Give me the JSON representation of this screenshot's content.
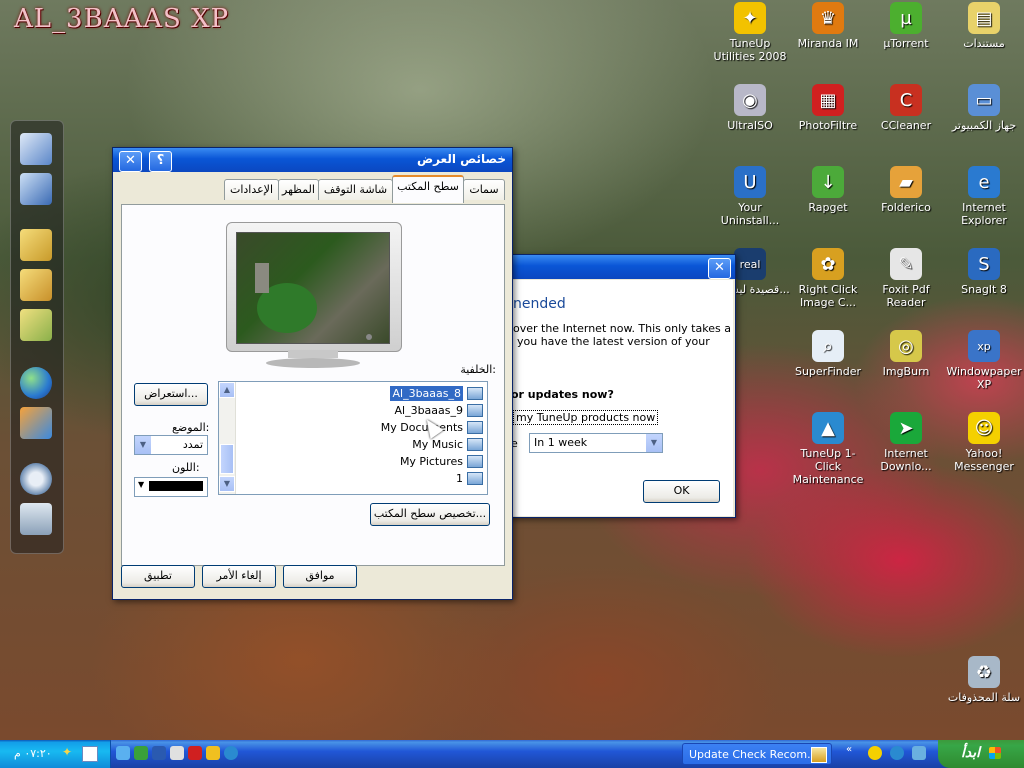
{
  "desktop": {
    "logo_text": "AL_3BAAAS XP",
    "icons": [
      {
        "label": "TuneUp Utilities 2008",
        "icon": "tuneup-icon",
        "color": "#f2c200",
        "glyph": "✦"
      },
      {
        "label": "Miranda IM",
        "icon": "miranda-icon",
        "color": "#e07a10",
        "glyph": "♛"
      },
      {
        "label": "µTorrent",
        "icon": "utorrent-icon",
        "color": "#4caf2f",
        "glyph": "µ"
      },
      {
        "label": "مستندات",
        "icon": "documents-icon",
        "color": "#e8d26a",
        "glyph": "▤"
      },
      {
        "label": "UltraISO",
        "icon": "ultraiso-icon",
        "color": "#b8b8c8",
        "glyph": "◉"
      },
      {
        "label": "PhotoFiltre",
        "icon": "photofiltre-icon",
        "color": "#d02020",
        "glyph": "▦"
      },
      {
        "label": "CCleaner",
        "icon": "ccleaner-icon",
        "color": "#c83020",
        "glyph": "C"
      },
      {
        "label": "جهاز الكمبيوتر",
        "icon": "my-computer-icon",
        "color": "#5a8fd6",
        "glyph": "▭"
      },
      {
        "label": "Your Uninstall...",
        "icon": "your-uninstaller-icon",
        "color": "#2a70c8",
        "glyph": "U"
      },
      {
        "label": "Rapget",
        "icon": "rapget-icon",
        "color": "#4caa3a",
        "glyph": "↓"
      },
      {
        "label": "Folderico",
        "icon": "folderico-icon",
        "color": "#e6a23a",
        "glyph": "▰"
      },
      {
        "label": "Internet Explorer",
        "icon": "internet-explorer-icon",
        "color": "#2a7ad0",
        "glyph": "e"
      },
      {
        "label": "قصيدة ليس لها...",
        "icon": "realplayer-icon",
        "color": "#1a3d6e",
        "glyph": "real"
      },
      {
        "label": "Right Click Image C...",
        "icon": "right-click-image-icon",
        "color": "#d8a020",
        "glyph": "✿"
      },
      {
        "label": "Foxit Pdf Reader",
        "icon": "foxit-reader-icon",
        "color": "#e6e6e6",
        "glyph": "✎"
      },
      {
        "label": "SnagIt 8",
        "icon": "snagit-icon",
        "color": "#2a6ac0",
        "glyph": "S"
      },
      {
        "label": "SuperFinder",
        "icon": "superfinder-icon",
        "color": "#e6eef6",
        "glyph": "⌕"
      },
      {
        "label": "ImgBurn",
        "icon": "imgburn-icon",
        "color": "#d6c84a",
        "glyph": "◎"
      },
      {
        "label": "Windowpaper XP",
        "icon": "windowpaper-icon",
        "color": "#3a74c8",
        "glyph": "xp"
      },
      {
        "label": "TuneUp 1-Click Maintenance",
        "icon": "tuneup-1click-icon",
        "color": "#2a8ad0",
        "glyph": "▲"
      },
      {
        "label": "Internet Downlo...",
        "icon": "internet-download-icon",
        "color": "#1aa83a",
        "glyph": "➤"
      },
      {
        "label": "Yahoo! Messenger",
        "icon": "yahoo-messenger-icon",
        "color": "#f4d000",
        "glyph": "☺"
      },
      {
        "label": "سلة المحذوفات",
        "icon": "recycle-bin-icon",
        "color": "#a8b8c8",
        "glyph": "♻"
      }
    ]
  },
  "display_props": {
    "title": "خصائص العرض",
    "help_btn": "؟",
    "close_btn": "✕",
    "tabs": [
      "سمات",
      "سطح المكتب",
      "شاشة التوقف",
      "المظهر",
      "الإعدادات"
    ],
    "background_label": "الخلفية:",
    "browse_btn": "استعراض...",
    "position_label": "الموضع:",
    "position_value": "تمدد",
    "color_label": "اللون:",
    "backgrounds": [
      "Al_3baaas_8",
      "Al_3baaas_9",
      "My Documents",
      "My Music",
      "My Pictures",
      "1"
    ],
    "selected_index": 0,
    "customize_btn": "تخصيص سطح المكتب...",
    "ok_btn": "موافق",
    "cancel_btn": "إلغاء الأمر",
    "apply_btn": "تطبيق"
  },
  "tuneup_dialog": {
    "close_btn": "✕",
    "heading": "nended",
    "body_line1": "over the Internet now. This only takes a",
    "body_line2": "you have the latest version of your",
    "question": "or updates now?",
    "checkbox_label": "my TuneUp products now",
    "reminder_prefix": "e",
    "reminder_value": "In 1 week",
    "ok_btn": "OK"
  },
  "taskbar": {
    "start_label": "ابدأ",
    "task_label": "Update Check Recom...",
    "clock": "٠٧:٢٠ م"
  },
  "dock": {
    "items": [
      "my-computer-icon",
      "network-icon",
      "folder-icon",
      "folder-icon",
      "folder-icon",
      "globe-icon",
      "media-player-icon",
      "settings-icon",
      "recycle-bin-icon"
    ]
  }
}
